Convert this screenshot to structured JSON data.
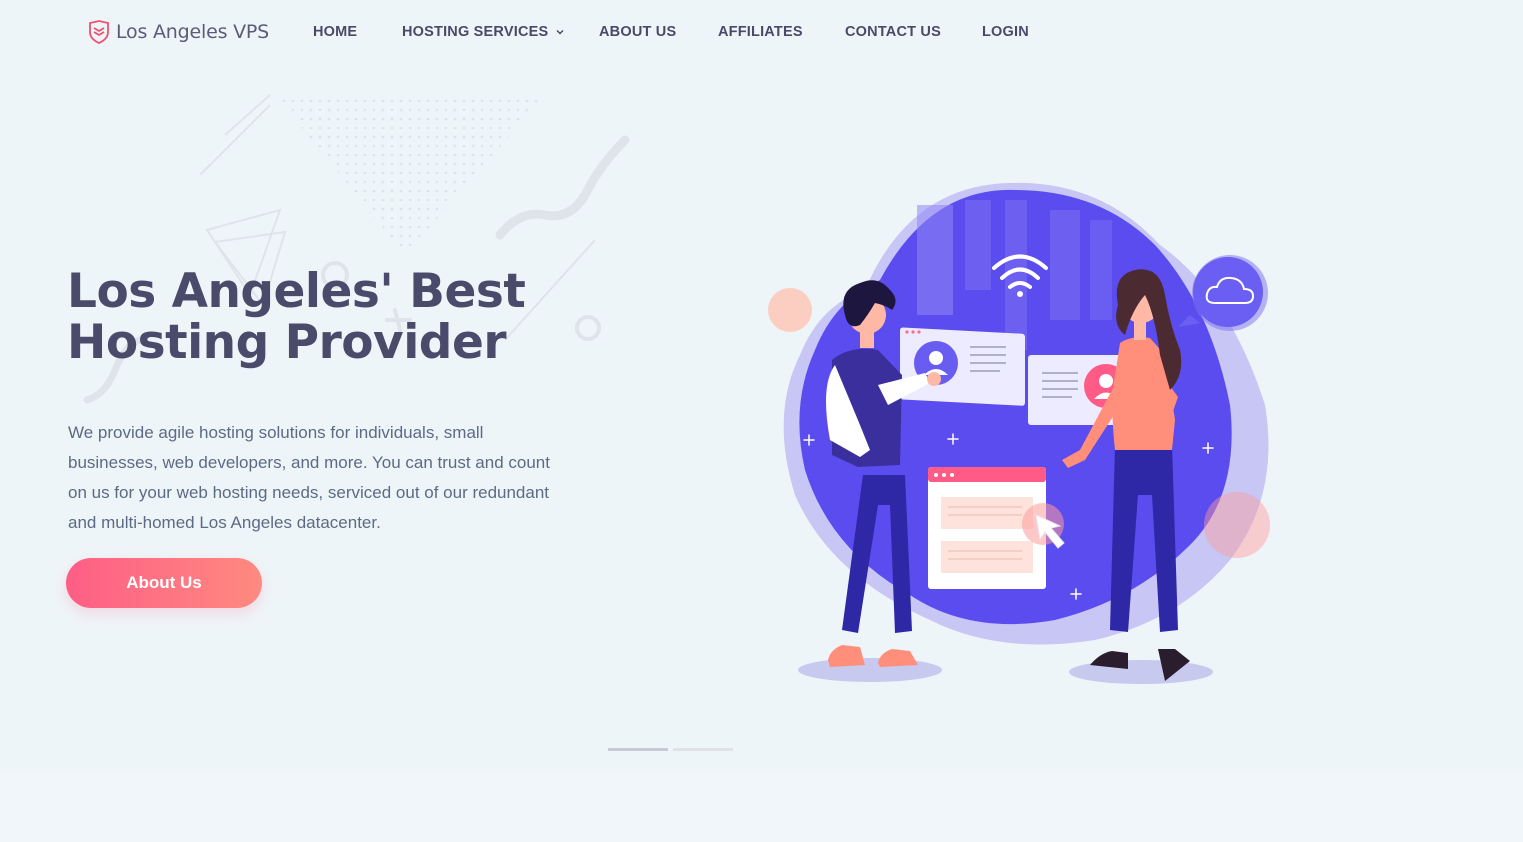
{
  "brand": {
    "name": "Los Angeles VPS",
    "logo_icon": "shield-logo-icon",
    "color": "#f0516e"
  },
  "nav": {
    "items": [
      {
        "label": "HOME"
      },
      {
        "label": "HOSTING SERVICES",
        "has_dropdown": true
      },
      {
        "label": "ABOUT US"
      },
      {
        "label": "AFFILIATES"
      },
      {
        "label": "CONTACT US"
      },
      {
        "label": "LOGIN"
      }
    ]
  },
  "hero": {
    "headline_line1": "Los Angeles' Best",
    "headline_line2": "Hosting Provider",
    "description": "We provide agile hosting solutions for individuals, small businesses, web developers, and more. You can trust and count on us for your web hosting needs, serviced out of our redundant and multi-homed Los Angeles datacenter.",
    "cta_label": "About Us"
  },
  "slider": {
    "slide_count": 2,
    "active_index": 0
  },
  "colors": {
    "heading": "#4a4a6a",
    "accent_gradient_start": "#fe5e85",
    "accent_gradient_end": "#ff8a80",
    "illustration_blob": "#5b4cef",
    "background": "#eef5f8"
  }
}
